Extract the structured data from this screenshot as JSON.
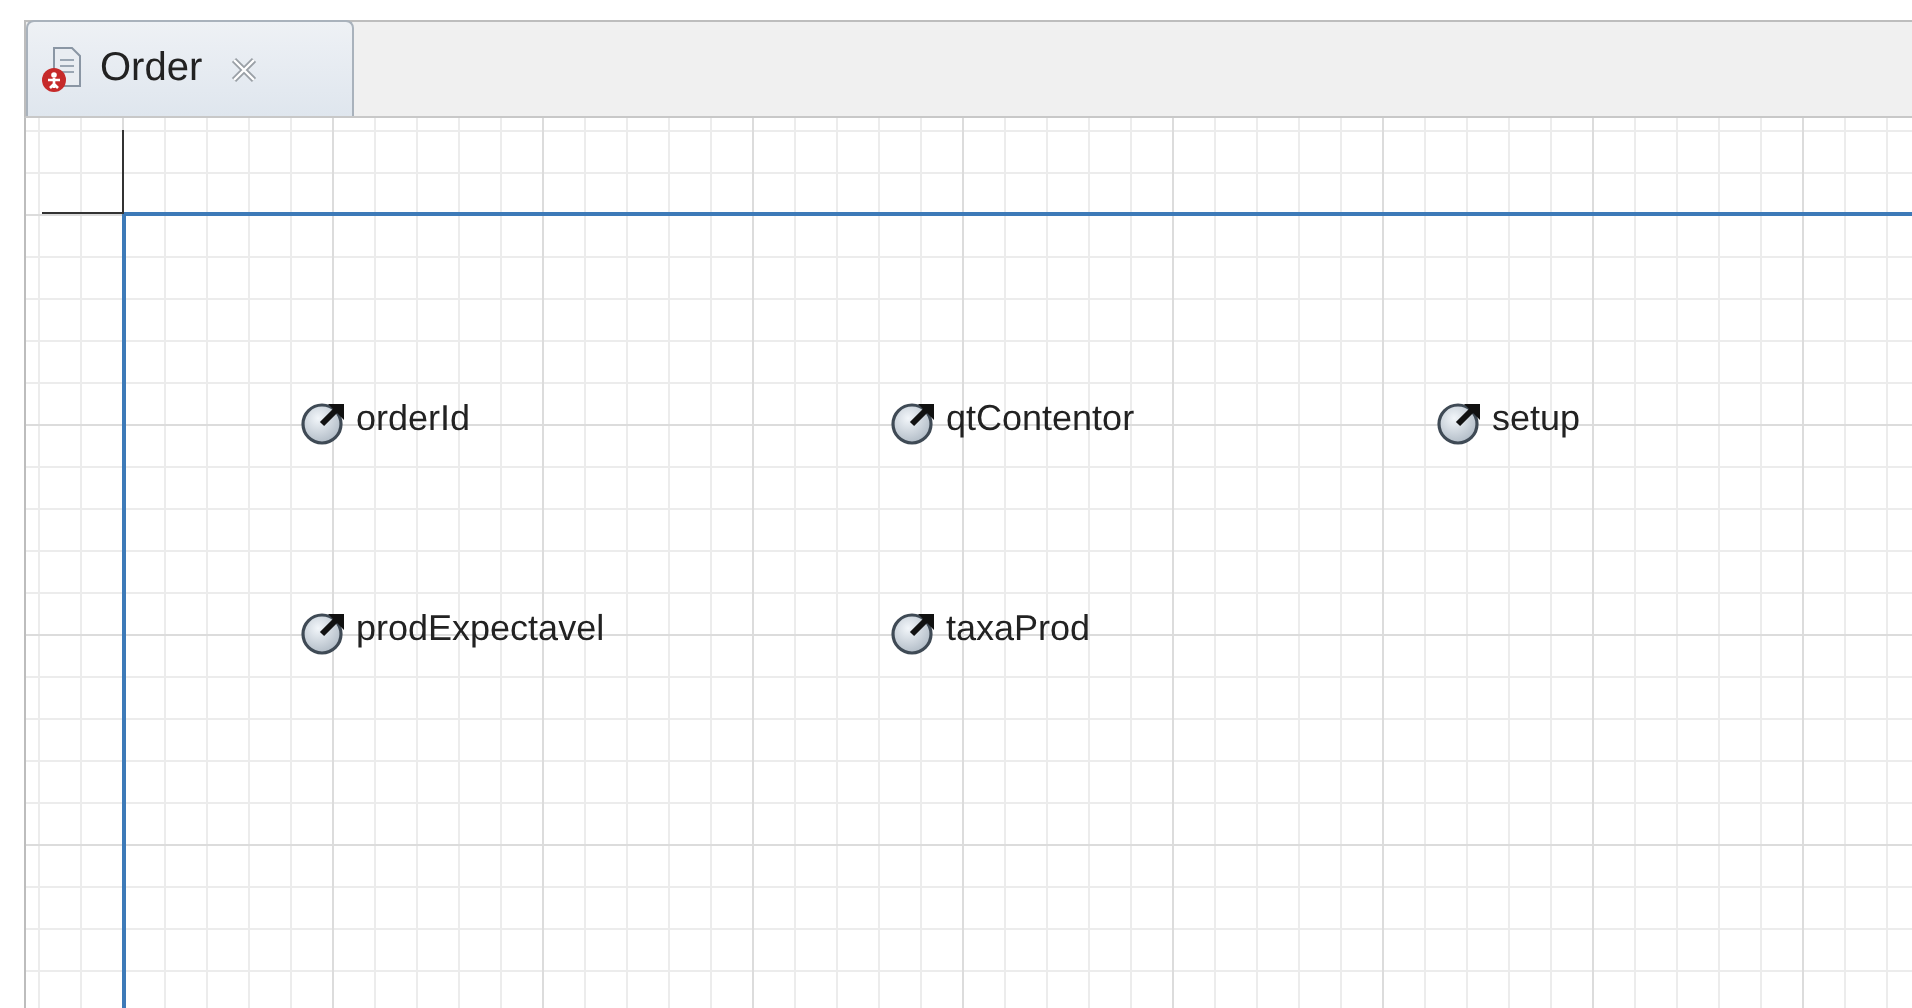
{
  "tab": {
    "title": "Order"
  },
  "variable_rows": [
    [
      {
        "name": "orderId"
      },
      {
        "name": "qtContentor"
      },
      {
        "name": "setup"
      }
    ],
    [
      {
        "name": "prodExpectavel"
      },
      {
        "name": "taxaProd"
      }
    ]
  ]
}
